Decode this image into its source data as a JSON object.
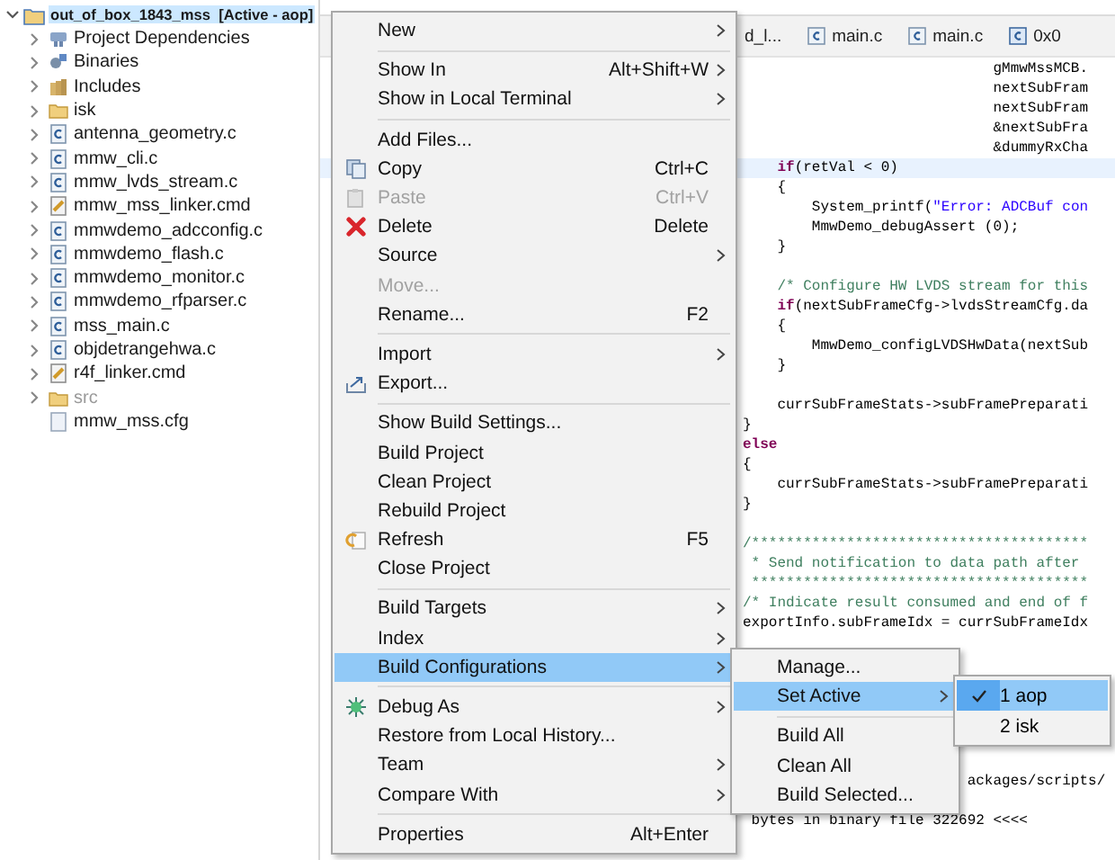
{
  "project_tree": {
    "root": {
      "label": "out_of_box_1843_mss  [Active - aop]",
      "expanded": true,
      "selected": true,
      "children": [
        {
          "label": "Project Dependencies",
          "kind": "dependencies",
          "expandable": true,
          "dimmed": false
        },
        {
          "label": "Binaries",
          "kind": "binaries",
          "expandable": true,
          "dimmed": false
        },
        {
          "label": "Includes",
          "kind": "includes",
          "expandable": true,
          "dimmed": false
        },
        {
          "label": "isk",
          "kind": "folder",
          "expandable": true,
          "dimmed": false
        },
        {
          "label": "antenna_geometry.c",
          "kind": "c-file",
          "expandable": true,
          "dimmed": false
        },
        {
          "label": "mmw_cli.c",
          "kind": "c-file",
          "expandable": true,
          "dimmed": false
        },
        {
          "label": "mmw_lvds_stream.c",
          "kind": "c-file",
          "expandable": true,
          "dimmed": false
        },
        {
          "label": "mmw_mss_linker.cmd",
          "kind": "cmd-file",
          "expandable": true,
          "dimmed": false
        },
        {
          "label": "mmwdemo_adcconfig.c",
          "kind": "c-file",
          "expandable": true,
          "dimmed": false
        },
        {
          "label": "mmwdemo_flash.c",
          "kind": "c-file",
          "expandable": true,
          "dimmed": false
        },
        {
          "label": "mmwdemo_monitor.c",
          "kind": "c-file",
          "expandable": true,
          "dimmed": false
        },
        {
          "label": "mmwdemo_rfparser.c",
          "kind": "c-file",
          "expandable": true,
          "dimmed": false
        },
        {
          "label": "mss_main.c",
          "kind": "c-file",
          "expandable": true,
          "dimmed": false
        },
        {
          "label": "objdetrangehwa.c",
          "kind": "c-file",
          "expandable": true,
          "dimmed": false
        },
        {
          "label": "r4f_linker.cmd",
          "kind": "cmd-file",
          "expandable": true,
          "dimmed": false
        },
        {
          "label": "src",
          "kind": "folder",
          "expandable": true,
          "dimmed": true
        },
        {
          "label": "mmw_mss.cfg",
          "kind": "cfg-file",
          "expandable": false,
          "dimmed": false
        }
      ]
    }
  },
  "editor": {
    "tabs": [
      {
        "label": "d_l...",
        "kind": "plain"
      },
      {
        "label": "main.c",
        "kind": "c-file"
      },
      {
        "label": "main.c",
        "kind": "c-file"
      },
      {
        "label": "0x0",
        "kind": "disasm"
      }
    ],
    "lines": [
      {
        "current": false,
        "segments": [
          {
            "kind": "code",
            "text": "                             gMmwMssMCB."
          }
        ]
      },
      {
        "current": false,
        "segments": [
          {
            "kind": "code",
            "text": "                             nextSubFram"
          }
        ]
      },
      {
        "current": false,
        "segments": [
          {
            "kind": "code",
            "text": "                             nextSubFram"
          }
        ]
      },
      {
        "current": false,
        "segments": [
          {
            "kind": "code",
            "text": "                             &nextSubFra"
          }
        ]
      },
      {
        "current": false,
        "segments": [
          {
            "kind": "code",
            "text": "                             &dummyRxCha"
          }
        ]
      },
      {
        "current": true,
        "segments": [
          {
            "kind": "keyword",
            "text": "    if"
          },
          {
            "kind": "code",
            "text": "(retVal < 0)"
          }
        ]
      },
      {
        "current": false,
        "segments": [
          {
            "kind": "code",
            "text": "    {"
          }
        ]
      },
      {
        "current": false,
        "segments": [
          {
            "kind": "code",
            "text": "        System_printf("
          },
          {
            "kind": "string",
            "text": "\"Error: ADCBuf con"
          }
        ]
      },
      {
        "current": false,
        "segments": [
          {
            "kind": "code",
            "text": "        MmwDemo_debugAssert (0);"
          }
        ]
      },
      {
        "current": false,
        "segments": [
          {
            "kind": "code",
            "text": "    }"
          }
        ]
      },
      {
        "current": false
      },
      {
        "current": false,
        "segments": [
          {
            "kind": "comment",
            "text": "    /* Configure HW LVDS stream for this"
          }
        ]
      },
      {
        "current": false,
        "segments": [
          {
            "kind": "keyword",
            "text": "    if"
          },
          {
            "kind": "code",
            "text": "(nextSubFrameCfg->lvdsStreamCfg.da"
          }
        ]
      },
      {
        "current": false,
        "segments": [
          {
            "kind": "code",
            "text": "    {"
          }
        ]
      },
      {
        "current": false,
        "segments": [
          {
            "kind": "code",
            "text": "        MmwDemo_configLVDSHwData(nextSub"
          }
        ]
      },
      {
        "current": false,
        "segments": [
          {
            "kind": "code",
            "text": "    }"
          }
        ]
      },
      {
        "current": false
      },
      {
        "current": false,
        "segments": [
          {
            "kind": "code",
            "text": "    currSubFrameStats->subFramePreparati"
          }
        ]
      },
      {
        "current": false,
        "segments": [
          {
            "kind": "code",
            "text": "}"
          }
        ]
      },
      {
        "current": false,
        "segments": [
          {
            "kind": "keyword",
            "text": "else"
          }
        ]
      },
      {
        "current": false,
        "segments": [
          {
            "kind": "code",
            "text": "{"
          }
        ]
      },
      {
        "current": false,
        "segments": [
          {
            "kind": "code",
            "text": "    currSubFrameStats->subFramePreparati"
          }
        ]
      },
      {
        "current": false,
        "segments": [
          {
            "kind": "code",
            "text": "}"
          }
        ]
      },
      {
        "current": false
      },
      {
        "current": false,
        "segments": [
          {
            "kind": "comment",
            "text": "/***************************************"
          }
        ]
      },
      {
        "current": false,
        "segments": [
          {
            "kind": "comment",
            "text": " * Send notification to data path after"
          }
        ]
      },
      {
        "current": false,
        "segments": [
          {
            "kind": "comment",
            "text": " ***************************************"
          }
        ]
      },
      {
        "current": false,
        "segments": [
          {
            "kind": "comment",
            "text": "/* Indicate result consumed and end of f"
          }
        ]
      },
      {
        "current": false,
        "segments": [
          {
            "kind": "code",
            "text": "exportInfo.subFrameIdx = currSubFrameIdx"
          }
        ]
      },
      {
        "current": false
      },
      {
        "current": false
      },
      {
        "current": false
      },
      {
        "current": false
      },
      {
        "current": false
      },
      {
        "current": false
      },
      {
        "current": false
      },
      {
        "current": false,
        "segments": [
          {
            "kind": "code",
            "text": "                          ackages/scripts/"
          }
        ]
      },
      {
        "current": false
      },
      {
        "current": false,
        "segments": [
          {
            "kind": "code",
            "text": " bytes in binary file 322692 <<<<"
          }
        ]
      }
    ]
  },
  "context_menu": {
    "sections": [
      [
        {
          "label": "New",
          "kind": "plain",
          "submenu": true,
          "disabled": false,
          "selected": false
        }
      ],
      [
        {
          "label": "Show In",
          "shortcut": "Alt+Shift+W",
          "kind": "plain",
          "submenu": true,
          "disabled": false,
          "selected": false
        },
        {
          "label": "Show in Local Terminal",
          "kind": "plain",
          "submenu": true,
          "disabled": false,
          "selected": false
        }
      ],
      [
        {
          "label": "Add Files...",
          "kind": "plain",
          "submenu": false,
          "disabled": false,
          "selected": false
        },
        {
          "label": "Copy",
          "shortcut": "Ctrl+C",
          "kind": "copy",
          "submenu": false,
          "disabled": false,
          "selected": false
        },
        {
          "label": "Paste",
          "shortcut": "Ctrl+V",
          "kind": "paste",
          "submenu": false,
          "disabled": true,
          "selected": false
        },
        {
          "label": "Delete",
          "shortcut": "Delete",
          "kind": "delete",
          "submenu": false,
          "disabled": false,
          "selected": false
        },
        {
          "label": "Source",
          "kind": "plain",
          "submenu": true,
          "disabled": false,
          "selected": false
        },
        {
          "label": "Move...",
          "kind": "plain",
          "submenu": false,
          "disabled": true,
          "selected": false
        },
        {
          "label": "Rename...",
          "shortcut": "F2",
          "kind": "plain",
          "submenu": false,
          "disabled": false,
          "selected": false
        }
      ],
      [
        {
          "label": "Import",
          "kind": "plain",
          "submenu": true,
          "disabled": false,
          "selected": false
        },
        {
          "label": "Export...",
          "kind": "export",
          "submenu": false,
          "disabled": false,
          "selected": false
        }
      ],
      [
        {
          "label": "Show Build Settings...",
          "kind": "plain",
          "submenu": false,
          "disabled": false,
          "selected": false
        },
        {
          "label": "Build Project",
          "kind": "plain",
          "submenu": false,
          "disabled": false,
          "selected": false
        },
        {
          "label": "Clean Project",
          "kind": "plain",
          "submenu": false,
          "disabled": false,
          "selected": false
        },
        {
          "label": "Rebuild Project",
          "kind": "plain",
          "submenu": false,
          "disabled": false,
          "selected": false
        },
        {
          "label": "Refresh",
          "shortcut": "F5",
          "kind": "refresh",
          "submenu": false,
          "disabled": false,
          "selected": false
        },
        {
          "label": "Close Project",
          "kind": "plain",
          "submenu": false,
          "disabled": false,
          "selected": false
        }
      ],
      [
        {
          "label": "Build Targets",
          "kind": "plain",
          "submenu": true,
          "disabled": false,
          "selected": false
        },
        {
          "label": "Index",
          "kind": "plain",
          "submenu": true,
          "disabled": false,
          "selected": false
        },
        {
          "label": "Build Configurations",
          "kind": "plain",
          "submenu": true,
          "disabled": false,
          "selected": true
        }
      ],
      [
        {
          "label": "Debug As",
          "kind": "debug",
          "submenu": true,
          "disabled": false,
          "selected": false
        },
        {
          "label": "Restore from Local History...",
          "kind": "plain",
          "submenu": false,
          "disabled": false,
          "selected": false
        },
        {
          "label": "Team",
          "kind": "plain",
          "submenu": true,
          "disabled": false,
          "selected": false
        },
        {
          "label": "Compare With",
          "kind": "plain",
          "submenu": true,
          "disabled": false,
          "selected": false
        }
      ],
      [
        {
          "label": "Properties",
          "shortcut": "Alt+Enter",
          "kind": "plain",
          "submenu": false,
          "disabled": false,
          "selected": false
        }
      ]
    ]
  },
  "build_configurations_menu": {
    "sections": [
      [
        {
          "label": "Manage...",
          "submenu": false,
          "selected": false
        },
        {
          "label": "Set Active",
          "submenu": true,
          "selected": true
        }
      ],
      [
        {
          "label": "Build All",
          "submenu": false,
          "selected": false
        },
        {
          "label": "Clean All",
          "submenu": false,
          "selected": false
        },
        {
          "label": "Build Selected...",
          "submenu": false,
          "selected": false
        }
      ]
    ]
  },
  "set_active_menu": {
    "items": [
      {
        "label": "1 aop",
        "checked": true,
        "selected": true
      },
      {
        "label": "2 isk",
        "checked": false,
        "selected": false
      }
    ]
  }
}
